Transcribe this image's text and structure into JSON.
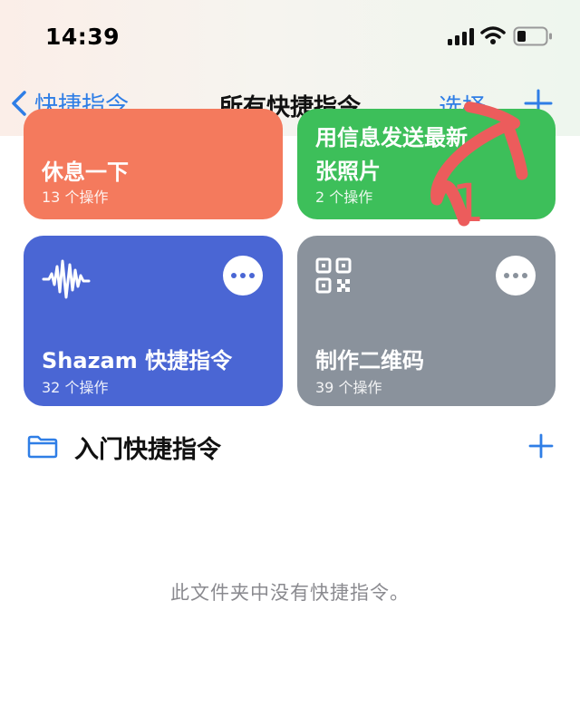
{
  "status_bar": {
    "time": "14:39"
  },
  "nav": {
    "back_label": "快捷指令",
    "title": "所有快捷指令",
    "select_label": "选择"
  },
  "cards": [
    {
      "name": "休息一下",
      "count": "13 个操作",
      "color": "#f47a5d"
    },
    {
      "name": "用信息发送最新",
      "name_line2": "张照片",
      "count": "2 个操作",
      "color": "#3dbf5a"
    },
    {
      "name": "Shazam 快捷指令",
      "count": "32 个操作",
      "color": "#4a66d4",
      "icon": "waveform-icon"
    },
    {
      "name": "制作二维码",
      "count": "39 个操作",
      "color": "#8a929c",
      "icon": "qr-code-icon"
    }
  ],
  "folder": {
    "title": "入门快捷指令",
    "empty_message": "此文件夹中没有快捷指令。"
  },
  "annotation": {
    "number": "1",
    "color": "#ec5c5c"
  },
  "colors": {
    "accent": "#2f7ee6"
  }
}
